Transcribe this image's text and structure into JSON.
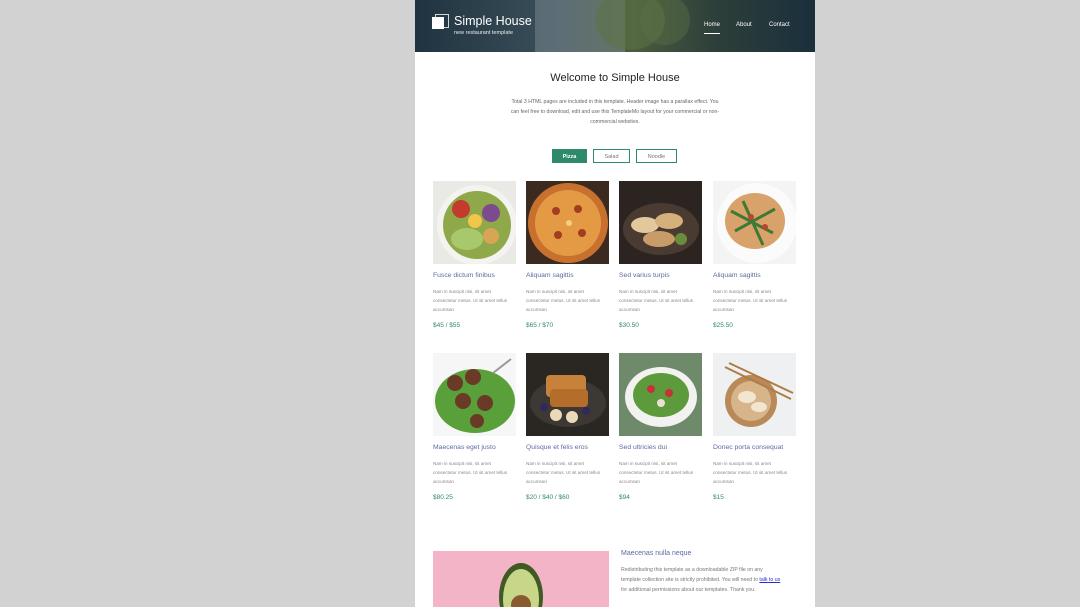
{
  "header": {
    "site_title": "Simple House",
    "tagline": "new restaurant template",
    "nav": [
      "Home",
      "About",
      "Contact"
    ]
  },
  "welcome": {
    "title": "Welcome to Simple House",
    "text": "Total 3 HTML pages are included in this template. Header image has a parallax effect. You can feel free to download, edit and use this TemplateMo layout for your commercial or non-commercial websites."
  },
  "tabs": [
    "Pizza",
    "Salad",
    "Noodle"
  ],
  "items": [
    {
      "name": "Fusce dictum finibus",
      "desc": "Nam in suscipit nisi, sit amet consectetur metus. Ut sit amet tellus accumsan",
      "price": "$45 / $55"
    },
    {
      "name": "Aliquam sagittis",
      "desc": "Nam in suscipit nisi, sit amet consectetur metus. Ut sit amet tellus accumsan",
      "price": "$65 / $70"
    },
    {
      "name": "Sed varius turpis",
      "desc": "Nam in suscipit nisi, sit amet consectetur metus. Ut sit amet tellus accumsan",
      "price": "$30.50"
    },
    {
      "name": "Aliquam sagittis",
      "desc": "Nam in suscipit nisi, sit amet consectetur metus. Ut sit amet tellus accumsan",
      "price": "$25.50"
    },
    {
      "name": "Maecenas eget justo",
      "desc": "Nam in suscipit nisi, sit amet consectetur metus. Ut sit amet tellus accumsan",
      "price": "$80.25"
    },
    {
      "name": "Quisque et felis eros",
      "desc": "Nam in suscipit nisi, sit amet consectetur metus. Ut sit amet tellus accumsan",
      "price": "$20 / $40 / $60"
    },
    {
      "name": "Sed ultricies dui",
      "desc": "Nam in suscipit nisi, sit amet consectetur metus. Ut sit amet tellus accumsan",
      "price": "$94"
    },
    {
      "name": "Donec porta consequat",
      "desc": "Nam in suscipit nisi, sit amet consectetur metus. Ut sit amet tellus accumsan",
      "price": "$15"
    }
  ],
  "about": {
    "title": "Maecenas nulla neque",
    "text_before": "Redistributing this template as a downloadable ZIP file on any template collection site is strictly prohibited. You will need to ",
    "link": "talk to us",
    "text_after": " for additional permissions about our templates. Thank you."
  },
  "colors": {
    "accent": "#2f8a6a",
    "title": "#5c6aa0",
    "link": "#2b2bd6",
    "background": "#d2d2d2"
  }
}
